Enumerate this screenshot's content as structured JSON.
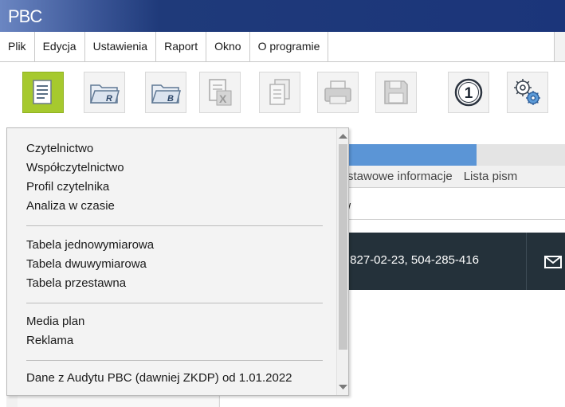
{
  "app": {
    "logo_text": "PBC"
  },
  "menubar": {
    "items": [
      {
        "label": "Plik"
      },
      {
        "label": "Edycja"
      },
      {
        "label": "Ustawienia"
      },
      {
        "label": "Raport"
      },
      {
        "label": "Okno"
      },
      {
        "label": "O programie"
      }
    ]
  },
  "toolbar": {
    "buttons": [
      {
        "icon": "report-document-icon",
        "active": true
      },
      {
        "icon": "folder-r-icon"
      },
      {
        "icon": "folder-b-icon"
      },
      {
        "icon": "excel-export-icon"
      },
      {
        "icon": "copy-document-icon"
      },
      {
        "icon": "printer-icon"
      },
      {
        "icon": "floppy-save-icon"
      },
      {
        "icon": "number-one-circle-icon",
        "symbol": "1"
      },
      {
        "icon": "settings-gears-icon"
      }
    ]
  },
  "background": {
    "tabs_text": "stawowe informacje",
    "tabs_text_2": "Lista pism",
    "url_text": "/",
    "phone_text": ") 827-02-23, 504-285-416"
  },
  "dropdown": {
    "group1": [
      "Czytelnictwo",
      "Współczytelnictwo",
      "Profil czytelnika",
      "Analiza w czasie"
    ],
    "group2": [
      "Tabela jednowymiarowa",
      "Tabela dwuwymiarowa",
      "Tabela przestawna"
    ],
    "group3": [
      "Media plan",
      "Reklama"
    ],
    "group4": [
      "Dane z Audytu PBC (dawniej ZKDP) od 1.01.2022"
    ]
  },
  "colors": {
    "titlebar": "#1b357a",
    "active_button": "#a6c92e",
    "blue_bar": "#5b95d6",
    "dark_banner": "#24313a"
  }
}
